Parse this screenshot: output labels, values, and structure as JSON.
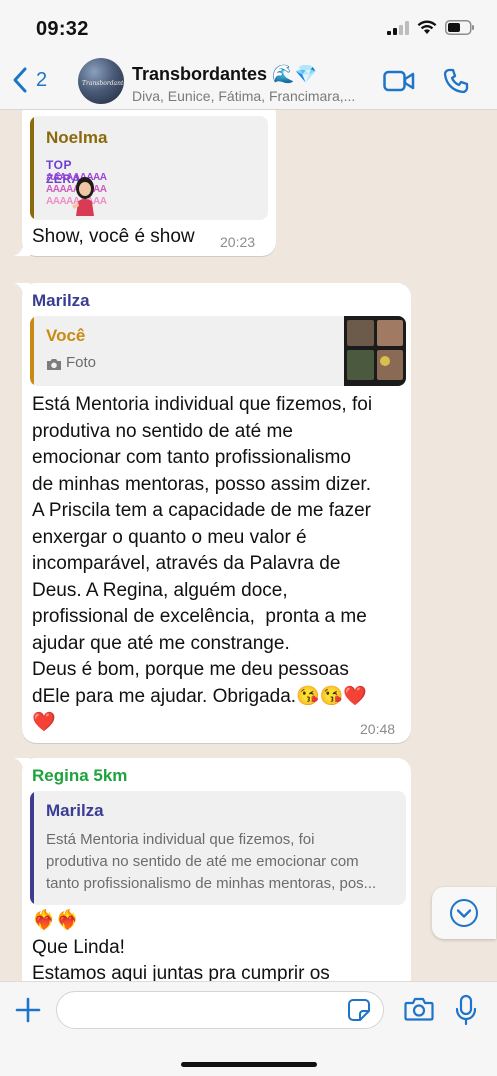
{
  "status_bar": {
    "time": "09:32"
  },
  "header": {
    "back_count": "2",
    "group_name": "Transbordantes 🌊💎",
    "members": "Diva, Eunice, Fátima, Francimara,...",
    "avatar_text": "Transbordantes"
  },
  "messages": [
    {
      "quote": {
        "author": "Noelma",
        "sticker_title": "TOP ZÊRA",
        "sticker_text": "AAAAAAAAA"
      },
      "text": "Show, você é show",
      "time": "20:23"
    },
    {
      "sender": "Marilza",
      "quote": {
        "author": "Você",
        "media_label": "Foto"
      },
      "text": "Está Mentoria individual que fizemos, foi\nprodutiva no sentido de até me\nemocionar com tanto profissionalismo\nde minhas mentoras, posso assim dizer.\nA Priscila tem a capacidade de me fazer\nenxergar o quanto o meu valor é\nincomparável, através da Palavra de\nDeus. A Regina, alguém doce,\nprofissional de excelência,  pronta a me\najudar que até me constrange.\nDeus é bom, porque me deu pessoas\ndEle para me ajudar. Obrigada.😘😘❤️\n❤️",
      "time": "20:48"
    },
    {
      "sender": "Regina 5km",
      "quote": {
        "author": "Marilza",
        "text": "Está Mentoria individual que fizemos, foi\nprodutiva no sentido de até me emocionar com\ntanto profissionalismo de minhas mentoras, pos..."
      },
      "text": "❤️‍🔥❤️‍🔥\nQue Linda!\nEstamos aqui juntas pra cumprir os"
    }
  ],
  "colors": {
    "noelma": "#8a6a0c",
    "marilza": "#3b3d92",
    "voce": "#c98a12",
    "regina": "#1ea43c",
    "accent": "#1e74c8"
  },
  "icons": [
    "battery-icon",
    "wifi-icon",
    "signal-icon",
    "chevron-left-icon",
    "video-icon",
    "phone-icon",
    "camera-icon",
    "chevron-down-icon",
    "plus-icon",
    "sticker-icon",
    "mic-icon"
  ]
}
